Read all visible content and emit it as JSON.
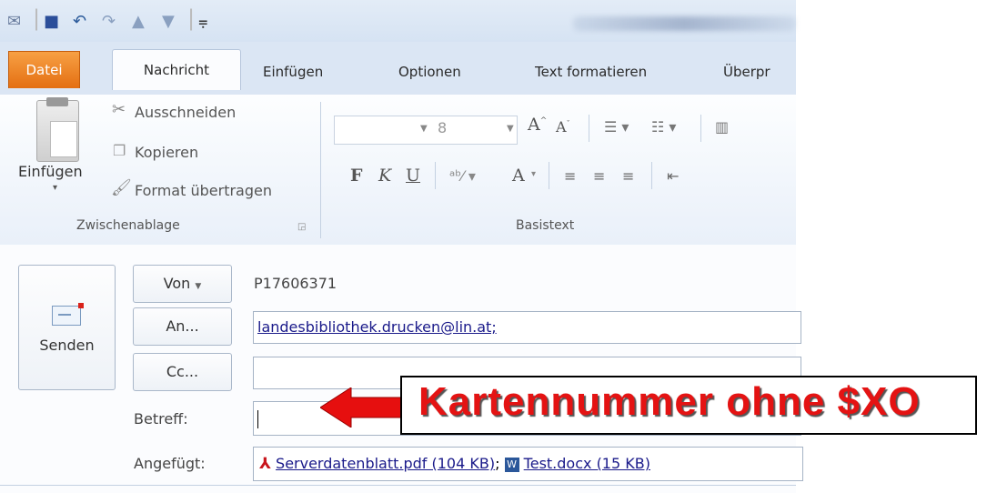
{
  "quick_access": {
    "icons": [
      "outlook-icon",
      "save-icon",
      "undo-icon",
      "redo-icon",
      "up-arrow-icon",
      "down-arrow-icon",
      "customize-qat-icon"
    ]
  },
  "tabs": [
    "Datei",
    "Nachricht",
    "Einfügen",
    "Optionen",
    "Text formatieren",
    "Überpr"
  ],
  "ribbon": {
    "clipboard": {
      "paste_label": "Einfügen",
      "cut_label": "Ausschneiden",
      "copy_label": "Kopieren",
      "format_painter_label": "Format übertragen",
      "group_label": "Zwischenablage"
    },
    "basic_text": {
      "font_size": "8",
      "bold": "F",
      "italic": "K",
      "underline": "U",
      "group_label": "Basistext"
    }
  },
  "compose": {
    "send_label": "Senden",
    "from_label": "Von",
    "from_value": "P17606371",
    "to_label": "An...",
    "to_value": "landesbibliothek.drucken@lin.at;",
    "cc_label": "Cc...",
    "cc_value": "",
    "subject_label": "Betreff:",
    "subject_value": "",
    "attached_label": "Angefügt:",
    "attachments": [
      {
        "name": "Serverdatenblatt.pdf (104 KB)",
        "icon": "pdf-icon",
        "separator": ";"
      },
      {
        "name": "Test.docx (15 KB)",
        "icon": "word-icon"
      }
    ]
  },
  "annotation": {
    "text": "Kartennummer ohne $XO",
    "color": "#e41313"
  }
}
